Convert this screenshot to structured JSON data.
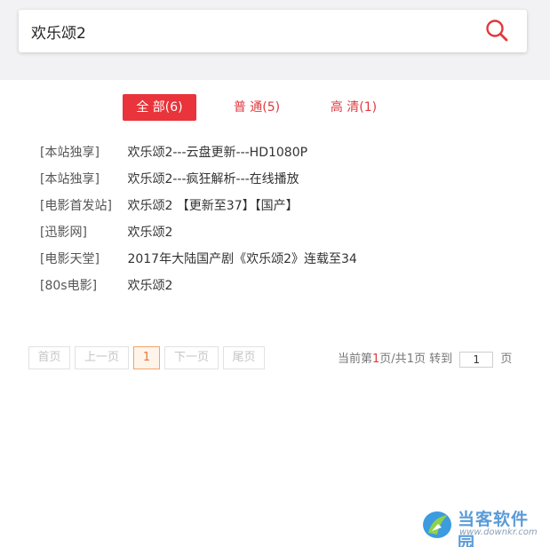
{
  "search": {
    "value": "欢乐颂2"
  },
  "tabs": [
    {
      "label": "全 部(6)",
      "active": true
    },
    {
      "label": "普 通(5)",
      "active": false
    },
    {
      "label": "高 清(1)",
      "active": false
    }
  ],
  "results": [
    {
      "source": "[本站独享]",
      "title": "欢乐颂2---云盘更新---HD1080P"
    },
    {
      "source": "[本站独享]",
      "title": "欢乐颂2---疯狂解析---在线播放"
    },
    {
      "source": "[电影首发站]",
      "title": "欢乐颂2 【更新至37】【国产】"
    },
    {
      "source": "[迅影网]",
      "title": "欢乐颂2"
    },
    {
      "source": "[电影天堂]",
      "title": "2017年大陆国产剧《欢乐颂2》连载至34"
    },
    {
      "source": "[80s电影]",
      "title": "欢乐颂2"
    }
  ],
  "pager": {
    "first": "首页",
    "prev": "上一页",
    "current": "1",
    "next": "下一页",
    "last": "尾页"
  },
  "page_info": {
    "prefix": "当前第",
    "current": "1",
    "mid": "页/共",
    "total": "1",
    "suffix": "页 转到",
    "goto_value": "1",
    "unit": "页"
  },
  "watermark": {
    "text": "当客软件园",
    "url": "www.downkr.com"
  },
  "colors": {
    "accent": "#e8343a",
    "search_icon": "#e0393e"
  },
  "icons": {
    "search": "search-icon",
    "watermark_logo": "logo-icon"
  }
}
